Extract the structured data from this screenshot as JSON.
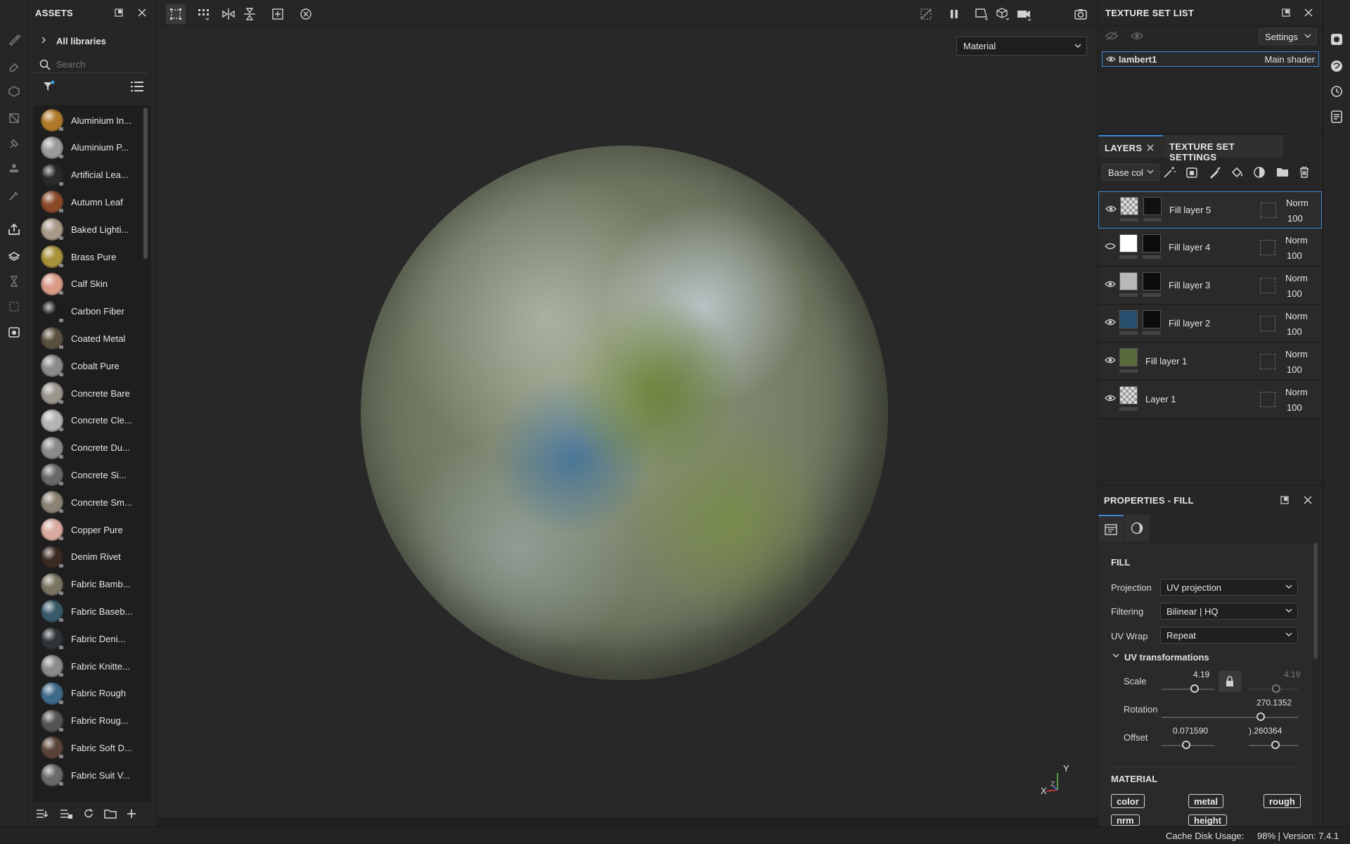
{
  "assets": {
    "title": "ASSETS",
    "breadcrumb": "All libraries",
    "search_placeholder": "Search",
    "items": [
      {
        "label": "Aluminium In...",
        "color": "#b07a2a"
      },
      {
        "label": "Aluminium P...",
        "color": "#9a9a9a"
      },
      {
        "label": "Artificial Lea...",
        "color": "#2a2a2a"
      },
      {
        "label": "Autumn Leaf",
        "color": "#8a4a2a"
      },
      {
        "label": "Baked Lighti...",
        "color": "#a89a88"
      },
      {
        "label": "Brass Pure",
        "color": "#a8923a"
      },
      {
        "label": "Calf Skin",
        "color": "#d99a88"
      },
      {
        "label": "Carbon Fiber",
        "color": "#1e1e1e"
      },
      {
        "label": "Coated Metal",
        "color": "#5a5040"
      },
      {
        "label": "Cobalt Pure",
        "color": "#8a8a8a"
      },
      {
        "label": "Concrete Bare",
        "color": "#9a968e"
      },
      {
        "label": "Concrete Cle...",
        "color": "#b4b4b4"
      },
      {
        "label": "Concrete Du...",
        "color": "#8a8a8a"
      },
      {
        "label": "Concrete Si...",
        "color": "#6a6a6a"
      },
      {
        "label": "Concrete Sm...",
        "color": "#8c8274"
      },
      {
        "label": "Copper Pure",
        "color": "#d8aaa0"
      },
      {
        "label": "Denim Rivet",
        "color": "#3a2a22"
      },
      {
        "label": "Fabric Bamb...",
        "color": "#7a7462"
      },
      {
        "label": "Fabric Baseb...",
        "color": "#3a5a6a"
      },
      {
        "label": "Fabric Deni...",
        "color": "#2e3438"
      },
      {
        "label": "Fabric Knitte...",
        "color": "#8a8a8a"
      },
      {
        "label": "Fabric Rough",
        "color": "#3e6a8a"
      },
      {
        "label": "Fabric Roug...",
        "color": "#555555"
      },
      {
        "label": "Fabric Soft D...",
        "color": "#5a4438"
      },
      {
        "label": "Fabric Suit V...",
        "color": "#6a6a6a"
      }
    ]
  },
  "viewport": {
    "material_mode": "Material"
  },
  "texture_set_list": {
    "title": "TEXTURE SET LIST",
    "settings_label": "Settings",
    "set_name": "lambert1",
    "shader": "Main shader"
  },
  "layers_panel": {
    "tab_layers": "LAYERS",
    "tab_settings": "TEXTURE SET SETTINGS",
    "channel": "Base col",
    "layers": [
      {
        "name": "Fill layer 5",
        "blend": "Norm",
        "opacity": "100",
        "visible": true,
        "selected": true
      },
      {
        "name": "Fill layer 4",
        "blend": "Norm",
        "opacity": "100",
        "visible": false,
        "selected": false
      },
      {
        "name": "Fill layer 3",
        "blend": "Norm",
        "opacity": "100",
        "visible": true,
        "selected": false
      },
      {
        "name": "Fill layer 2",
        "blend": "Norm",
        "opacity": "100",
        "visible": true,
        "selected": false
      },
      {
        "name": "Fill layer 1",
        "blend": "Norm",
        "opacity": "100",
        "visible": true,
        "selected": false
      },
      {
        "name": "Layer 1",
        "blend": "Norm",
        "opacity": "100",
        "visible": true,
        "selected": false
      }
    ]
  },
  "properties": {
    "title": "PROPERTIES - FILL",
    "section_fill": "FILL",
    "projection_label": "Projection",
    "projection_value": "UV projection",
    "filtering_label": "Filtering",
    "filtering_value": "Bilinear | HQ",
    "uvwrap_label": "UV Wrap",
    "uvwrap_value": "Repeat",
    "uv_transform_label": "UV transformations",
    "scale_label": "Scale",
    "scale_value": "4.19",
    "scale_value2": "4.19",
    "rotation_label": "Rotation",
    "rotation_value": "270.1352",
    "offset_label": "Offset",
    "offset_x": "0.071590",
    "offset_y": ").260364",
    "section_material": "MATERIAL",
    "chips": [
      "color",
      "metal",
      "rough",
      "nrm",
      "height"
    ]
  },
  "status": {
    "cache_label": "Cache Disk Usage:",
    "cache_value": "98% | Version: 7.4.1"
  },
  "axis": {
    "x": "X",
    "y": "Y",
    "z": "Z"
  }
}
